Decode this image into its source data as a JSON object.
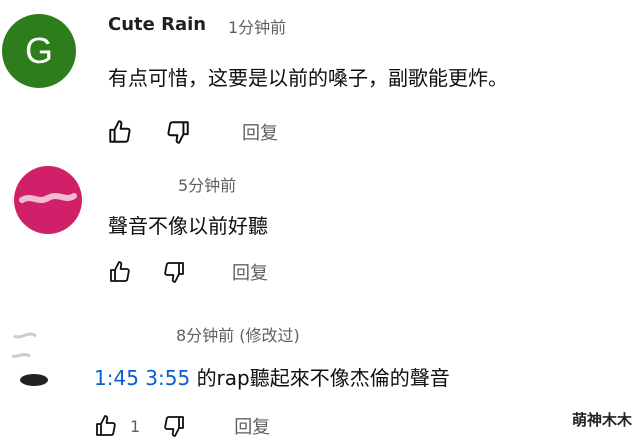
{
  "comments": [
    {
      "avatar_letter": "G",
      "avatar_color": "#2e7d1d",
      "author": "Cute Rain",
      "time": "1分钟前",
      "text": "有点可惜，这要是以前的嗓子，副歌能更炸。",
      "reply_label": "回复"
    },
    {
      "avatar_color": "#d1206a",
      "author": "",
      "time": "5分钟前",
      "text": "聲音不像以前好聽",
      "reply_label": "回复"
    },
    {
      "author": "",
      "time": "8分钟前 (修改过)",
      "timestamp_1": "1:45",
      "timestamp_2": "3:55",
      "text": "的rap聽起來不像杰倫的聲音",
      "like_count": "1",
      "reply_label": "回复"
    }
  ],
  "icons": {
    "like": "thumb-up-icon",
    "dislike": "thumb-down-icon"
  },
  "watermark": "萌神木木"
}
